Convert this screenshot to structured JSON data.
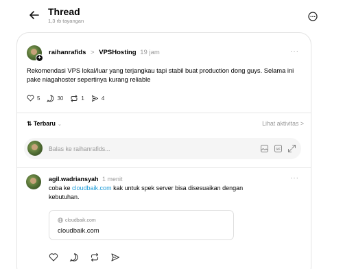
{
  "header": {
    "title": "Thread",
    "views": "1,3 rb tayangan"
  },
  "post": {
    "username": "raihanrafids",
    "separator": ">",
    "community": "VPSHosting",
    "time": "19 jam",
    "more": "···",
    "text": "Rekomendasi VPS lokal/luar yang terjangkau tapi stabil buat production dong guys. Selama ini pake niagahoster sepertinya kurang reliable",
    "likes": "5",
    "comments": "30",
    "reposts": "1",
    "shares": "4"
  },
  "sort": {
    "label": "Terbaru",
    "arrow": "⌄",
    "icon": "⇅",
    "activity_link": "Lihat aktivitas >"
  },
  "reply": {
    "placeholder": "Balas ke raihanrafids..."
  },
  "comment": {
    "username": "agil.wadriansyah",
    "time": "1 menit",
    "more": "···",
    "text_before": "coba ke ",
    "link": "cloudbaik.com",
    "text_after": " kak untuk spek server bisa disesuaikan dengan kebutuhan.",
    "link_card": {
      "domain": "cloudbaik.com",
      "title": "cloudbaik.com"
    }
  },
  "colors": {
    "link": "#1d9bd7",
    "muted": "#9a9a9a"
  }
}
